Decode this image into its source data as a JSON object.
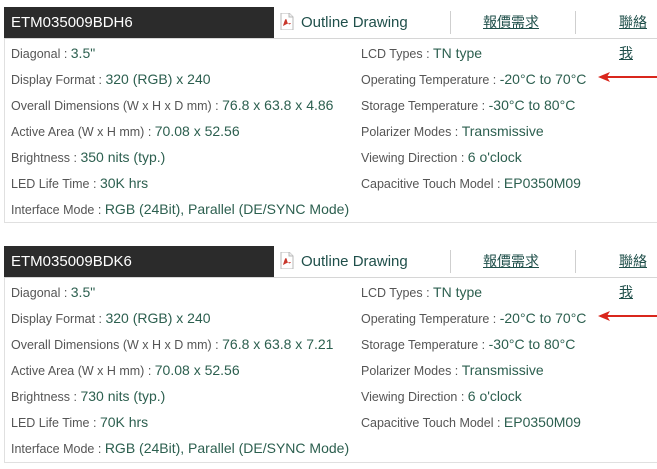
{
  "colors": {
    "header_bg": "#2b2b2b",
    "value": "#2c5f4f",
    "arrow": "#d9261c",
    "pdf_icon": "#c8362b"
  },
  "products": [
    {
      "model": "ETM035009BDH6",
      "outline": "Outline Drawing",
      "quote": "報價需求",
      "contact": "聯絡我",
      "left": [
        {
          "label": "Diagonal : ",
          "value": "3.5\""
        },
        {
          "label": "Display Format : ",
          "value": "320 (RGB) x 240"
        },
        {
          "label": "Overall Dimensions (W x H x D mm) : ",
          "value": "76.8 x 63.8 x 4.86"
        },
        {
          "label": "Active Area (W x H mm) : ",
          "value": "70.08 x 52.56"
        },
        {
          "label": "Brightness : ",
          "value": "350 nits (typ.)"
        },
        {
          "label": "LED Life Time : ",
          "value": "30K hrs"
        },
        {
          "label": "Interface Mode : ",
          "value": "RGB (24Bit), Parallel (DE/SYNC Mode)"
        }
      ],
      "right": [
        {
          "label": "LCD Types : ",
          "value": "TN type"
        },
        {
          "label": "Operating Temperature : ",
          "value": "-20°C to 70°C"
        },
        {
          "label": "Storage Temperature : ",
          "value": "-30°C to 80°C"
        },
        {
          "label": "Polarizer Modes : ",
          "value": "Transmissive"
        },
        {
          "label": "Viewing Direction : ",
          "value": "6 o'clock"
        },
        {
          "label": "Capacitive Touch Model : ",
          "value": "EP0350M09"
        }
      ]
    },
    {
      "model": "ETM035009BDK6",
      "outline": "Outline Drawing",
      "quote": "報價需求",
      "contact": "聯絡我",
      "left": [
        {
          "label": "Diagonal : ",
          "value": "3.5\""
        },
        {
          "label": "Display Format : ",
          "value": "320 (RGB) x 240"
        },
        {
          "label": "Overall Dimensions (W x H x D mm) : ",
          "value": "76.8 x 63.8 x 7.21"
        },
        {
          "label": "Active Area (W x H mm) : ",
          "value": "70.08 x 52.56"
        },
        {
          "label": "Brightness : ",
          "value": "730 nits (typ.)"
        },
        {
          "label": "LED Life Time : ",
          "value": "70K hrs"
        },
        {
          "label": "Interface Mode : ",
          "value": "RGB (24Bit), Parallel (DE/SYNC Mode)"
        }
      ],
      "right": [
        {
          "label": "LCD Types : ",
          "value": "TN type"
        },
        {
          "label": "Operating Temperature : ",
          "value": "-20°C to 70°C"
        },
        {
          "label": "Storage Temperature : ",
          "value": "-30°C to 80°C"
        },
        {
          "label": "Polarizer Modes : ",
          "value": "Transmissive"
        },
        {
          "label": "Viewing Direction : ",
          "value": "6 o'clock"
        },
        {
          "label": "Capacitive Touch Model : ",
          "value": "EP0350M09"
        }
      ]
    }
  ]
}
